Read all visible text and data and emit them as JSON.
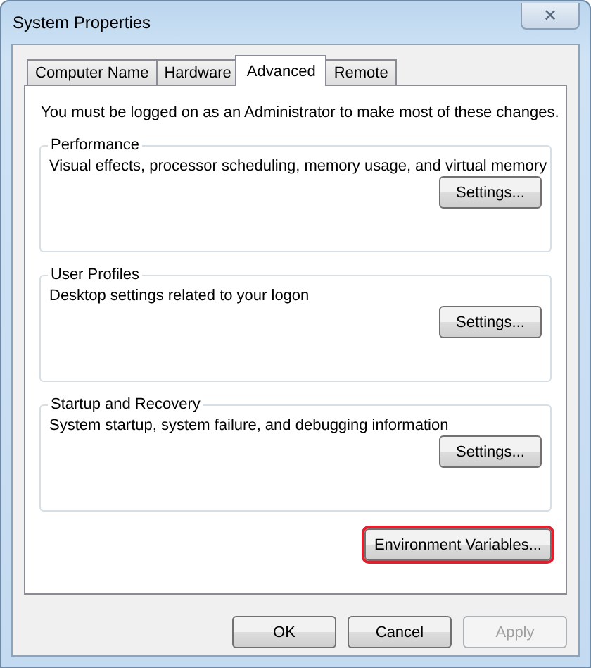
{
  "window": {
    "title": "System Properties",
    "close": "✕"
  },
  "tabs": [
    {
      "label": "Computer Name",
      "selected": false
    },
    {
      "label": "Hardware",
      "selected": false
    },
    {
      "label": "Advanced",
      "selected": true
    },
    {
      "label": "Remote",
      "selected": false
    }
  ],
  "notice": "You must be logged on as an Administrator to make most of these changes.",
  "groups": [
    {
      "title": "Performance",
      "description": "Visual effects, processor scheduling, memory usage, and virtual memory",
      "button": "Settings..."
    },
    {
      "title": "User Profiles",
      "description": "Desktop settings related to your logon",
      "button": "Settings..."
    },
    {
      "title": "Startup and Recovery",
      "description": "System startup, system failure, and debugging information",
      "button": "Settings..."
    }
  ],
  "env_button": {
    "label": "Environment Variables...",
    "highlighted": true
  },
  "buttons": [
    {
      "label": "OK",
      "disabled": false
    },
    {
      "label": "Cancel",
      "disabled": false
    },
    {
      "label": "Apply",
      "disabled": true
    }
  ]
}
